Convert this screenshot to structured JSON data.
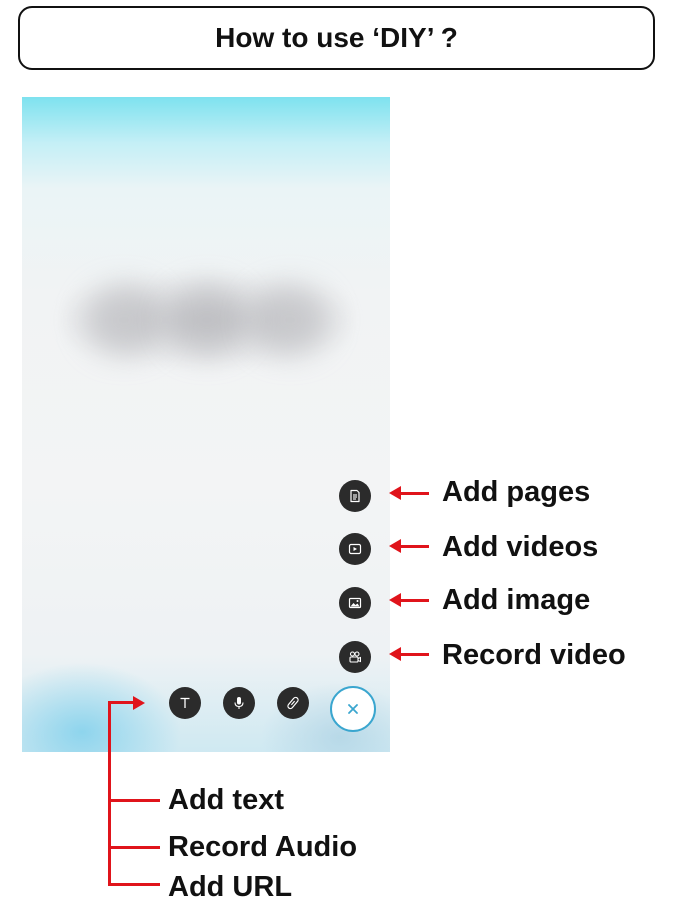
{
  "title": "How to use ‘DIY’ ?",
  "side_actions": [
    {
      "icon": "page-icon",
      "label": "Add pages"
    },
    {
      "icon": "video-play-icon",
      "label": "Add videos"
    },
    {
      "icon": "image-icon",
      "label": "Add image"
    },
    {
      "icon": "video-camera-icon",
      "label": "Record video"
    }
  ],
  "bottom_actions": [
    {
      "icon": "text-icon",
      "label": "Add text"
    },
    {
      "icon": "microphone-icon",
      "label": "Record Audio"
    },
    {
      "icon": "link-icon",
      "label": "Add URL"
    }
  ],
  "close_icon": "close-icon",
  "colors": {
    "annotation_red": "#e0141b",
    "button_dark": "#2b2b2b",
    "close_ring": "#3aa6cf"
  }
}
